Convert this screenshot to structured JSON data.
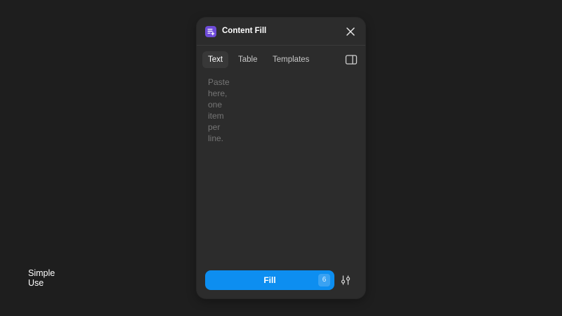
{
  "caption": {
    "text": "Simple\nUse"
  },
  "panel": {
    "title": "Content Fill",
    "app_icon": "content-fill-icon",
    "accent_color": "#6e4bd8",
    "tabs": [
      {
        "label": "Text",
        "active": true
      },
      {
        "label": "Table",
        "active": false
      },
      {
        "label": "Templates",
        "active": false
      }
    ],
    "textarea": {
      "placeholder": "Paste here, one item per line.",
      "value": ""
    },
    "fill_button": {
      "label": "Fill",
      "count": "6",
      "color": "#0d8ef0"
    },
    "icons": {
      "close": "close-icon",
      "sidebar": "sidebar-toggle-icon",
      "settings": "sliders-icon"
    }
  }
}
